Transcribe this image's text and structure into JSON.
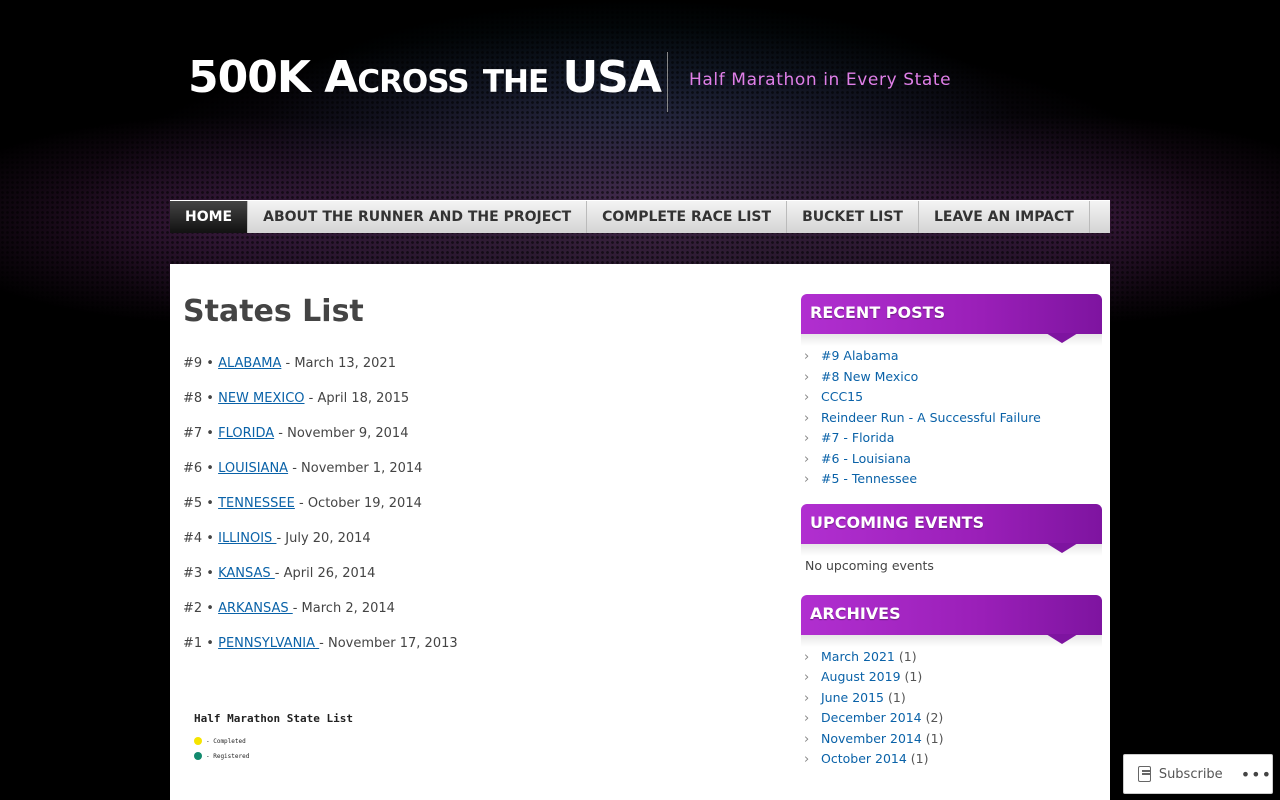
{
  "header": {
    "site_title": "500K Across the USA",
    "tagline": "Half Marathon in Every State"
  },
  "nav": {
    "items": [
      {
        "label": "HOME",
        "active": true
      },
      {
        "label": "ABOUT THE RUNNER AND THE PROJECT"
      },
      {
        "label": "COMPLETE RACE LIST"
      },
      {
        "label": "BUCKET LIST"
      },
      {
        "label": "LEAVE AN IMPACT"
      }
    ]
  },
  "main": {
    "page_title": "States List",
    "states": [
      {
        "num": "#9 •",
        "state": "ALABAMA",
        "date": " - March 13, 2021"
      },
      {
        "num": "#8 •",
        "state": "NEW MEXICO",
        "date": " - April 18, 2015"
      },
      {
        "num": "#7 •",
        "state": "FLORIDA",
        "date": " - November 9, 2014"
      },
      {
        "num": "#6 •",
        "state": "LOUISIANA",
        "date": " - November 1, 2014"
      },
      {
        "num": "#5 •",
        "state": "TENNESSEE",
        "date": " - October 19, 2014"
      },
      {
        "num": "#4 •",
        "state": "ILLINOIS ",
        "date": " - July 20, 2014"
      },
      {
        "num": "#3 •",
        "state": "KANSAS ",
        "date": " - April 26, 2014"
      },
      {
        "num": "#2 •",
        "state": "ARKANSAS ",
        "date": " - March 2, 2014"
      },
      {
        "num": "#1 •",
        "state": "PENNSYLVANIA ",
        "date": " - November 17, 2013"
      }
    ],
    "map": {
      "title": "Half Marathon State List",
      "legend": [
        {
          "label": "- Completed",
          "color": "#f5e400"
        },
        {
          "label": "- Registered",
          "color": "#128a6e"
        }
      ]
    }
  },
  "sidebar": {
    "recent_posts": {
      "title": "RECENT POSTS",
      "items": [
        "#9 Alabama",
        "#8 New Mexico",
        "CCC15",
        "Reindeer Run - A Successful Failure",
        "#7 - Florida",
        "#6 - Louisiana",
        "#5 - Tennessee"
      ]
    },
    "upcoming_events": {
      "title": "UPCOMING EVENTS",
      "text": "No upcoming events"
    },
    "archives": {
      "title": "ARCHIVES",
      "items": [
        {
          "label": "March 2021",
          "count": "(1)"
        },
        {
          "label": "August 2019",
          "count": "(1)"
        },
        {
          "label": "June 2015",
          "count": "(1)"
        },
        {
          "label": "December 2014",
          "count": "(2)"
        },
        {
          "label": "November 2014",
          "count": "(1)"
        },
        {
          "label": "October 2014",
          "count": "(1)"
        }
      ]
    }
  },
  "subscribe": {
    "label": "Subscribe",
    "more": "•••"
  },
  "colors": {
    "accent": "#9a1fb8",
    "link": "#0a62a8",
    "tagline": "#e07fe8"
  }
}
